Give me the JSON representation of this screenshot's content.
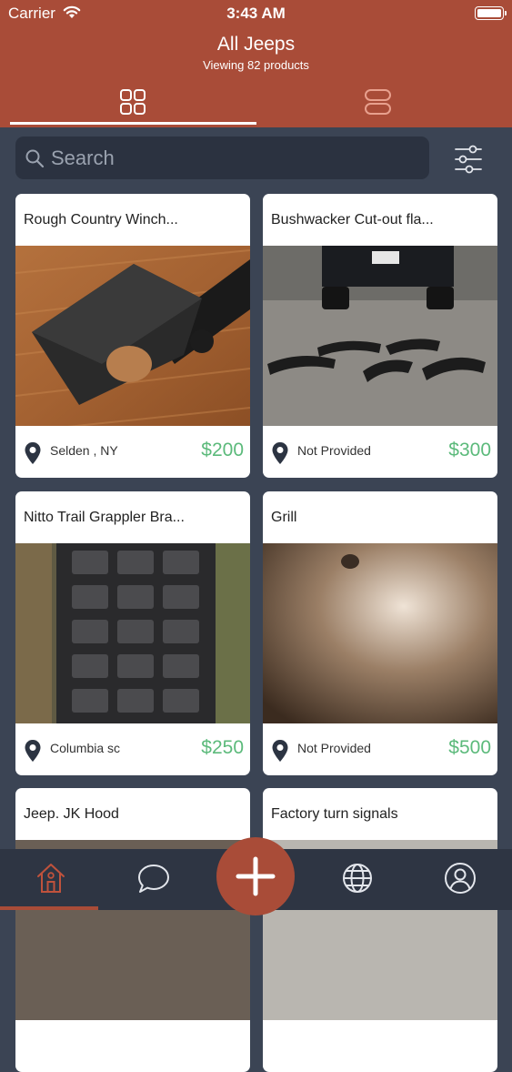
{
  "status_bar": {
    "carrier": "Carrier",
    "time": "3:43 AM"
  },
  "header": {
    "title": "All Jeeps",
    "subtitle": "Viewing 82 products"
  },
  "view_tabs": [
    {
      "icon": "grid-icon",
      "active": true
    },
    {
      "icon": "list-icon",
      "active": false
    }
  ],
  "search": {
    "placeholder": "Search"
  },
  "products": [
    {
      "title": "Rough Country Winch...",
      "location": "Selden , NY",
      "price": "$200"
    },
    {
      "title": "Bushwacker Cut-out fla...",
      "location": "Not Provided",
      "price": "$300"
    },
    {
      "title": "Nitto Trail Grappler Bra...",
      "location": "Columbia sc",
      "price": "$250"
    },
    {
      "title": "Grill",
      "location": "Not Provided",
      "price": "$500"
    },
    {
      "title": "Jeep. JK Hood",
      "location": "",
      "price": ""
    },
    {
      "title": "Factory turn signals",
      "location": "",
      "price": ""
    }
  ],
  "tab_bar": {
    "items": [
      "home-icon",
      "chat-icon",
      "add-icon",
      "globe-icon",
      "profile-icon"
    ],
    "active": "home-icon"
  },
  "colors": {
    "brand": "#a94c38",
    "background": "#3b4454",
    "price": "#5cba7b"
  }
}
